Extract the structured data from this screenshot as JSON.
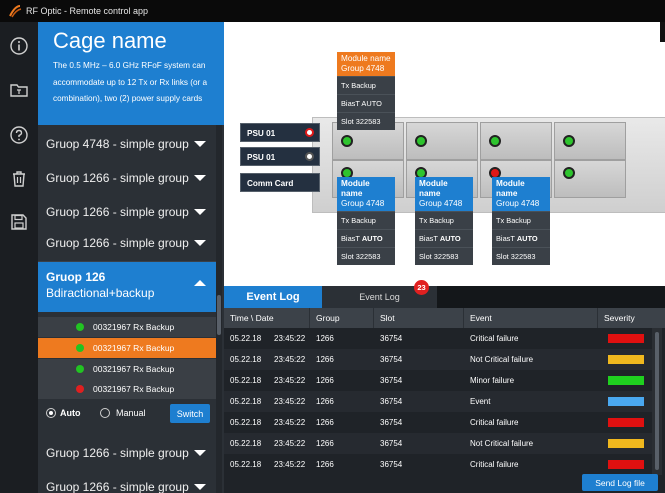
{
  "app": {
    "title": "RF Optic - Remote control app"
  },
  "rail": {
    "icons": [
      "info-icon",
      "folder-icon",
      "help-icon",
      "trash-icon",
      "save-icon"
    ]
  },
  "cage": {
    "title": "Cage name",
    "description": "The 0.5 MHz – 6.0 GHz RFoF system can accommodate up to 12 Tx or Rx links (or a combination), two (2) power supply cards"
  },
  "groups": [
    {
      "label": "Gruop 4748 - simple group"
    },
    {
      "label": "Gruop 1266 - simple group"
    },
    {
      "label": "Gruop 1266 - simple group"
    },
    {
      "label": "Gruop 1266 - simple group"
    }
  ],
  "open_group": {
    "title": "Gruop 126",
    "subtitle": "Bdiractional+backup"
  },
  "sub_items": [
    {
      "label": "00321967 Rx Backup",
      "status_color": "#22c322",
      "selected": false
    },
    {
      "label": "00321967 Rx Backup",
      "status_color": "#22c322",
      "selected": true
    },
    {
      "label": "00321967 Rx Backup",
      "status_color": "#22c322",
      "selected": false
    },
    {
      "label": "00321967 Rx Backup",
      "status_color": "#e02020",
      "selected": false
    }
  ],
  "mode": {
    "auto_label": "Auto",
    "manual_label": "Manual",
    "switch_label": "Switch",
    "selected": "Auto"
  },
  "groups_after": [
    {
      "label": "Gruop 1266 - simple group"
    },
    {
      "label": "Gruop 1266 - simple group"
    }
  ],
  "device": {
    "tooltips": [
      {
        "header1": "Module name",
        "header2": "Group 4748",
        "tx": "Tx Backup",
        "bias_label": "BiasT",
        "bias_value": "AUTO",
        "slot": "Slot 322583",
        "accent": "#ee7a1f"
      },
      {
        "header1": "Module name",
        "header2": "Group 4748",
        "tx": "Tx Backup",
        "bias_label": "BiasT",
        "bias_value": "AUTO",
        "slot": "Slot 322583",
        "accent": "#1e7fd0"
      },
      {
        "header1": "Module name",
        "header2": "Group 4748",
        "tx": "Tx Backup",
        "bias_label": "BiasT",
        "bias_value": "AUTO",
        "slot": "Slot 322583",
        "accent": "#1e7fd0"
      },
      {
        "header1": "Module name",
        "header2": "Group 4748",
        "tx": "Tx Backup",
        "bias_label": "BiasT",
        "bias_value": "AUTO",
        "slot": "Slot 322583",
        "accent": "#1e7fd0"
      }
    ],
    "psu1": "PSU 01",
    "psu2": "PSU 01",
    "comm": "Comm Card"
  },
  "log": {
    "tab_active": "Event Log",
    "tab_inactive": "Event Log",
    "badge_count": "23",
    "columns": [
      "Time \\ Date",
      "Group",
      "Slot",
      "Event",
      "Severity"
    ],
    "rows": [
      {
        "date": "05.22.18",
        "time": "23:45:22",
        "group": "1266",
        "slot": "36754",
        "event": "Critical failure",
        "severity_color": "#e01010"
      },
      {
        "date": "05.22.18",
        "time": "23:45:22",
        "group": "1266",
        "slot": "36754",
        "event": "Not Critical failure",
        "severity_color": "#f0b81e"
      },
      {
        "date": "05.22.18",
        "time": "23:45:22",
        "group": "1266",
        "slot": "36754",
        "event": "Minor failure",
        "severity_color": "#1fd01f"
      },
      {
        "date": "05.22.18",
        "time": "23:45:22",
        "group": "1266",
        "slot": "36754",
        "event": "Event",
        "severity_color": "#4aa8f0"
      },
      {
        "date": "05.22.18",
        "time": "23:45:22",
        "group": "1266",
        "slot": "36754",
        "event": "Critical failure",
        "severity_color": "#e01010"
      },
      {
        "date": "05.22.18",
        "time": "23:45:22",
        "group": "1266",
        "slot": "36754",
        "event": "Not Critical failure",
        "severity_color": "#f0b81e"
      },
      {
        "date": "05.22.18",
        "time": "23:45:22",
        "group": "1266",
        "slot": "36754",
        "event": "Critical failure",
        "severity_color": "#e01010"
      }
    ],
    "send_label": "Send Log file"
  }
}
